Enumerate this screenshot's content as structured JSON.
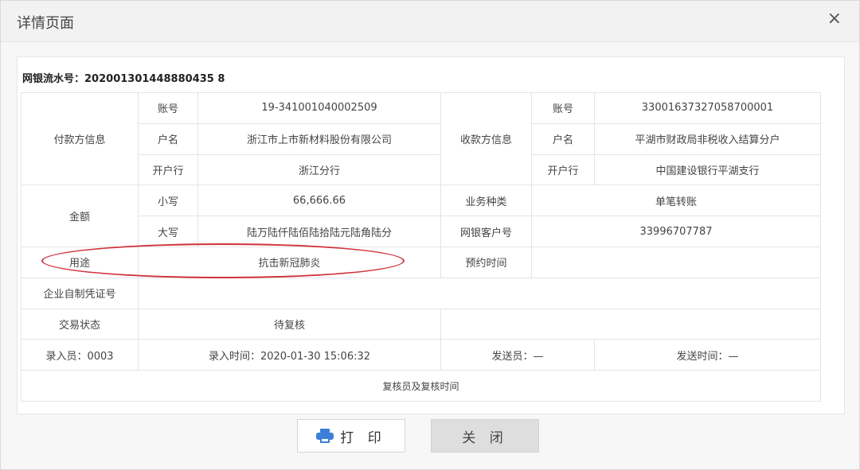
{
  "window": {
    "title": "详情页面",
    "close_symbol": "×"
  },
  "serial": {
    "label": "网银流水号：",
    "value": "202001301448880435 8"
  },
  "payer": {
    "section_label": "付款方信息",
    "account_label": "账号",
    "account": "19-341001040002509",
    "name_label": "户名",
    "name": "浙江市上市新材料股份有限公司",
    "bank_label": "开户行",
    "bank": "浙江分行"
  },
  "payee": {
    "section_label": "收款方信息",
    "account_label": "账号",
    "account": "33001637327058700001",
    "name_label": "户名",
    "name": "平湖市财政局非税收入结算分户",
    "bank_label": "开户行",
    "bank": "中国建设银行平湖支行"
  },
  "amount": {
    "section_label": "金额",
    "lower_label": "小写",
    "lower": "66,666.66",
    "upper_label": "大写",
    "upper": "陆万陆仟陆佰陆拾陆元陆角陆分"
  },
  "business_type": {
    "label": "业务种类",
    "value": "单笔转账"
  },
  "client_no": {
    "label": "网银客户号",
    "value": "33996707787"
  },
  "purpose": {
    "label": "用途",
    "value": "抗击新冠肺炎"
  },
  "reserve_time": {
    "label": "预约时间",
    "value": ""
  },
  "voucher_no": {
    "label": "企业自制凭证号",
    "value": ""
  },
  "trade_status": {
    "label": "交易状态",
    "value": "待复核"
  },
  "footer_row": {
    "entry_user": "录入员：0003",
    "entry_time": "录入时间：2020-01-30 15:06:32",
    "sender": "发送员：—",
    "send_time": "发送时间：—"
  },
  "review_link": "复核员及复核时间",
  "buttons": {
    "print": "打 印",
    "close": "关 闭"
  },
  "colors": {
    "highlight_ellipse": "#d0313b",
    "link": "#2a63c9",
    "print_icon": "#3b7fd6"
  }
}
